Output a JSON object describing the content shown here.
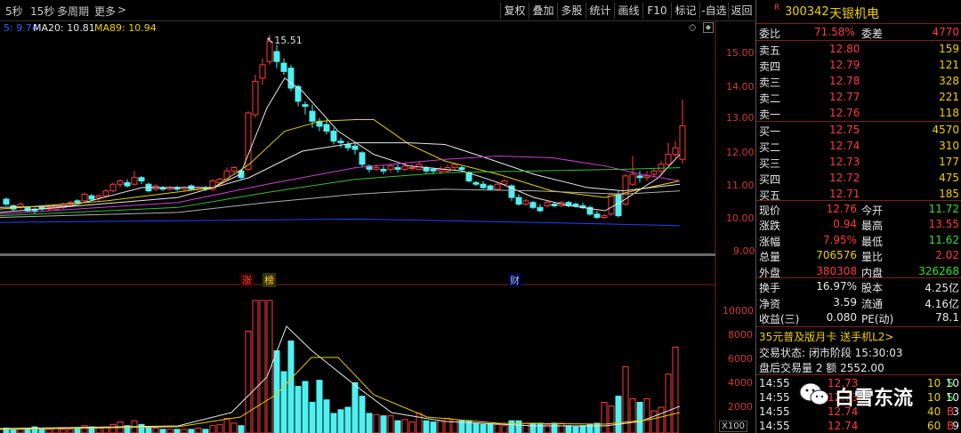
{
  "toolbar": {
    "timeframes": [
      "5秒",
      "15秒",
      "多周期",
      "更多"
    ],
    "more_arrow": ">",
    "buttons": [
      "复权",
      "叠加",
      "多股",
      "统计",
      "画线",
      "F10",
      "标记",
      "-自选",
      "返回"
    ]
  },
  "legend": {
    "ma5": "5: 9.74",
    "ma20": "MA20: 10.81",
    "ma89": "MA89: 10.94"
  },
  "chart": {
    "high_marker": "15.51",
    "price_ticks": [
      "15.00",
      "14.00",
      "13.00",
      "12.00",
      "11.00",
      "10.00",
      "9.00"
    ],
    "volume_ticks": [
      "10000",
      "8000",
      "6000",
      "4000",
      "2000"
    ],
    "volume_unit": "X100",
    "event_tags": [
      "涨",
      "榜",
      "财"
    ],
    "corner_icon": "diamond-icon"
  },
  "colors": {
    "up": "#ff3c3c",
    "down": "#4ff0f0",
    "ma_white": "#e8e8e8",
    "ma_yellow": "#e8d000",
    "ma_magenta": "#d040d0",
    "ma_green": "#30c030",
    "ma_gray": "#b0b0b0",
    "ma_blue": "#2040ff"
  },
  "stock": {
    "code": "300342",
    "name": "天银机电",
    "flag": "R"
  },
  "order_book": {
    "ratio_label": "委比",
    "ratio_value": "71.58%",
    "diff_label": "委差",
    "diff_value": "4770",
    "asks": [
      {
        "label": "卖五",
        "price": "12.80",
        "vol": "159"
      },
      {
        "label": "卖四",
        "price": "12.79",
        "vol": "121"
      },
      {
        "label": "卖三",
        "price": "12.78",
        "vol": "328"
      },
      {
        "label": "卖二",
        "price": "12.77",
        "vol": "221"
      },
      {
        "label": "卖一",
        "price": "12.76",
        "vol": "118"
      }
    ],
    "bids": [
      {
        "label": "买一",
        "price": "12.75",
        "vol": "4570"
      },
      {
        "label": "买二",
        "price": "12.74",
        "vol": "310"
      },
      {
        "label": "买三",
        "price": "12.73",
        "vol": "177"
      },
      {
        "label": "买四",
        "price": "12.72",
        "vol": "475"
      },
      {
        "label": "买五",
        "price": "12.71",
        "vol": "185"
      }
    ]
  },
  "quote": [
    {
      "l1": "现价",
      "v1": "12.76",
      "l2": "今开",
      "v2": "11.72"
    },
    {
      "l1": "涨跌",
      "v1": "0.94",
      "l2": "最高",
      "v2": "13.55"
    },
    {
      "l1": "涨幅",
      "v1": "7.95%",
      "l2": "最低",
      "v2": "11.62"
    },
    {
      "l1": "总量",
      "v1": "706576",
      "l2": "量比",
      "v2": "2.02"
    },
    {
      "l1": "外盘",
      "v1": "380308",
      "l2": "内盘",
      "v2": "326268"
    }
  ],
  "fundamentals": [
    {
      "l1": "换手",
      "v1": "16.97%",
      "l2": "股本",
      "v2": "4.25亿"
    },
    {
      "l1": "净资",
      "v1": "3.59",
      "l2": "流通",
      "v2": "4.16亿"
    },
    {
      "l1": "收益(三)",
      "v1": "0.080",
      "l2": "PE(动)",
      "v2": "78.1"
    }
  ],
  "promo": "35元普及版月卡 送手机L2>",
  "trade_status": "交易状态: 闭市阶段 15:30:03",
  "after_hours": "盘后交易量 2 额 2552.00",
  "ticks": [
    {
      "time": "14:55",
      "price": "12.73",
      "vol": "10",
      "side": "S",
      "n": "10"
    },
    {
      "time": "14:55",
      "price": "12.73",
      "vol": "10",
      "side": "S",
      "n": "10"
    },
    {
      "time": "14:55",
      "price": "12.74",
      "vol": "40",
      "side": "B",
      "n": "3"
    },
    {
      "time": "14:55",
      "price": "12.74",
      "vol": "60",
      "side": "B",
      "n": "9"
    }
  ],
  "watermark": "白雪东流"
}
